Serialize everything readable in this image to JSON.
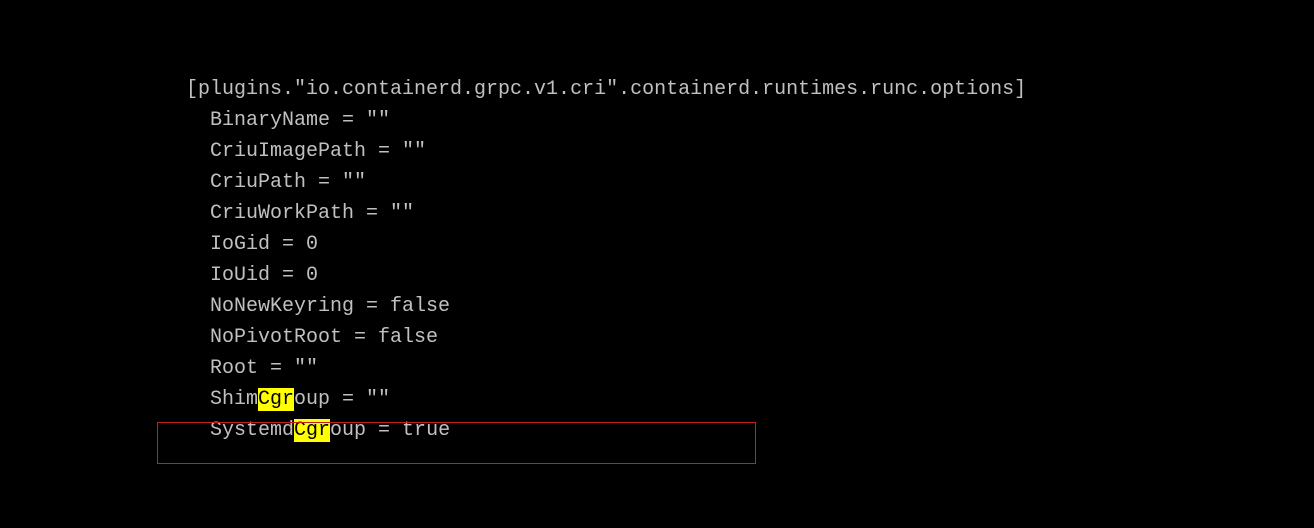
{
  "config": {
    "section_header": "[plugins.\"io.containerd.grpc.v1.cri\".containerd.runtimes.runc.options]",
    "indent": "  ",
    "lines": {
      "binary_name": "BinaryName = \"\"",
      "criu_image_path": "CriuImagePath = \"\"",
      "criu_path": "CriuPath = \"\"",
      "criu_work_path": "CriuWorkPath = \"\"",
      "io_gid": "IoGid = 0",
      "io_uid": "IoUid = 0",
      "no_new_keyring": "NoNewKeyring = false",
      "no_pivot_root": "NoPivotRoot = false",
      "root": "Root = \"\"",
      "shim_pre": "Shim",
      "shim_hl": "Cgr",
      "shim_post": "oup = \"\"",
      "systemd_pre": "Systemd",
      "systemd_hl": "Cgr",
      "systemd_post": "oup = true"
    }
  }
}
